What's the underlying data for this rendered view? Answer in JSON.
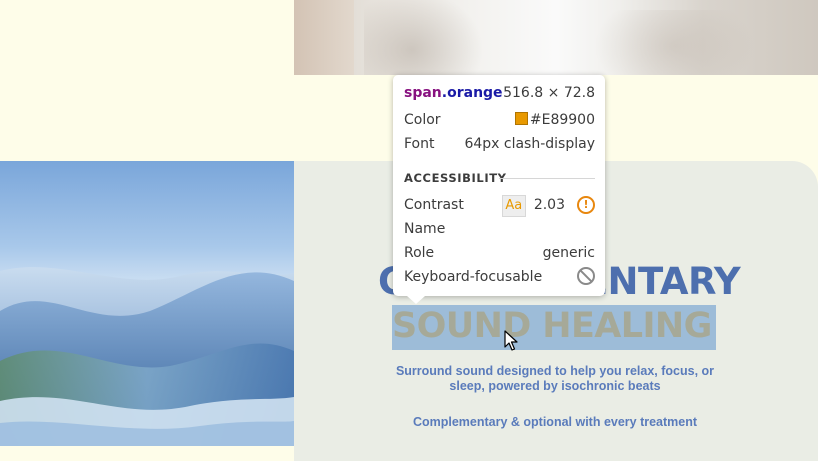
{
  "tooltip": {
    "selector_tag": "span",
    "selector_class": ".orange",
    "dimensions": "516.8 × 72.8",
    "color_label": "Color",
    "color_value": "#E89900",
    "font_label": "Font",
    "font_value": "64px clash-display",
    "section_title": "ACCESSIBILITY",
    "contrast_label": "Contrast",
    "contrast_badge": "Aa",
    "contrast_value": "2.03",
    "name_label": "Name",
    "role_label": "Role",
    "role_value": "generic",
    "keyboard_label": "Keyboard-focusable",
    "warning_icon": "warning-circle-icon",
    "keyboard_icon": "not-allowed-icon"
  },
  "content": {
    "heading_line1": "COMPLEMENTARY",
    "heading_line2": "SOUND HEALING",
    "description": "Surround sound designed to help you relax, focus, or sleep, powered by isochronic beats",
    "note": "Complementary & optional with every treatment"
  },
  "colors": {
    "page_bg": "#fefde9",
    "card_bg": "#eaede5",
    "heading_blue": "#4d6fae",
    "highlight": "#9dbcd8",
    "orange": "#E89900"
  }
}
